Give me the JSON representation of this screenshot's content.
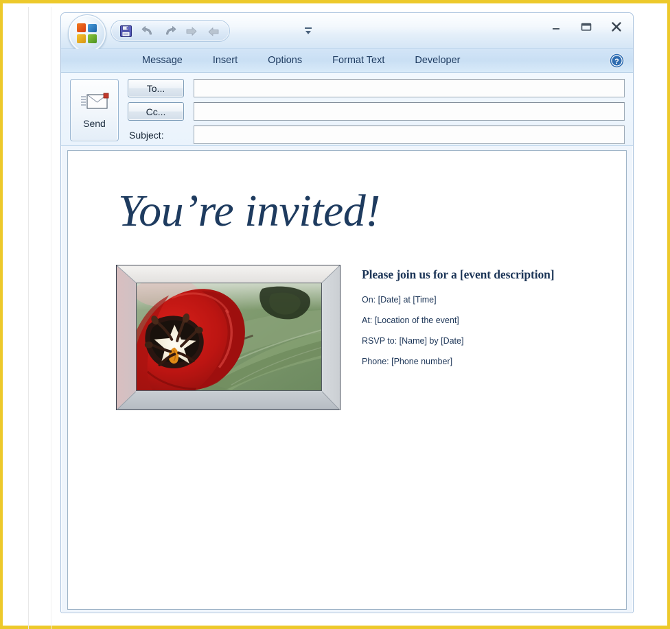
{
  "window": {
    "office_button": "office-logo",
    "quick_access": [
      {
        "name": "save",
        "icon": "save-icon",
        "label": "Save"
      },
      {
        "name": "undo",
        "icon": "undo-icon",
        "label": "Undo"
      },
      {
        "name": "redo",
        "icon": "redo-icon",
        "label": "Redo"
      },
      {
        "name": "previous",
        "icon": "previous-item-icon",
        "label": "Previous Item"
      },
      {
        "name": "next",
        "icon": "next-item-icon",
        "label": "Next Item"
      }
    ],
    "qat_dropdown_label": "Customize Quick Access Toolbar",
    "controls": [
      {
        "name": "minimize",
        "glyph": "—",
        "label": "Minimize"
      },
      {
        "name": "maximize",
        "glyph": "▭",
        "label": "Maximize"
      },
      {
        "name": "close",
        "glyph": "✕",
        "label": "Close"
      }
    ]
  },
  "ribbon": {
    "tabs": [
      {
        "label": "Message"
      },
      {
        "label": "Insert"
      },
      {
        "label": "Options"
      },
      {
        "label": "Format Text"
      },
      {
        "label": "Developer"
      }
    ],
    "active_tab": "Message",
    "help_label": "?"
  },
  "header": {
    "send_label": "Send",
    "send_icon": "envelope-send-icon",
    "to_label": "To...",
    "cc_label": "Cc...",
    "subject_label": "Subject:",
    "to_value": "",
    "cc_value": "",
    "subject_value": "",
    "to_placeholder": "",
    "cc_placeholder": "",
    "subject_placeholder": ""
  },
  "body": {
    "heading": "You’re invited!",
    "photo_alt": "red-tulip-photo",
    "event_title": "Please join us for a [event description]",
    "lines": [
      {
        "label": "On:",
        "value": "[Date] at [Time]",
        "text": "On:   [Date] at [Time]"
      },
      {
        "label": "At:",
        "value": "[Location of the event]",
        "text": "At:  [Location of the event]"
      },
      {
        "label": "RSVP to:",
        "value": "[Name] by [Date]",
        "text": "RSVP to:  [Name] by [Date]"
      },
      {
        "label": "Phone:",
        "value": "[Phone number]",
        "text": "Phone:  [Phone number]"
      }
    ]
  },
  "page": {
    "watermark": ""
  },
  "colors": {
    "page_border": "#edc92b",
    "heading_navy": "#1e3b5f",
    "text_navy": "#1c3557",
    "ribbon_blue": "#c9dff4",
    "window_border": "#a9c2de",
    "tulip_red": "#c21a16",
    "leaf_green": "#7e9a6d"
  }
}
